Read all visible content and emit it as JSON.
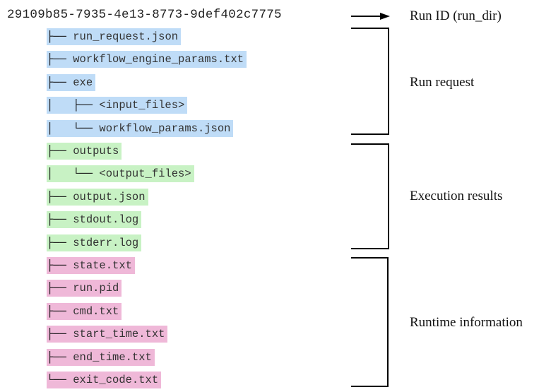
{
  "root": {
    "name": "29109b85-7935-4e13-8773-9def402c7775",
    "annotation": "Run ID (run_dir)"
  },
  "groups": [
    {
      "label": "Run request",
      "color": "#bfdcf7",
      "items": [
        {
          "prefix": "├── ",
          "name": "run_request.json"
        },
        {
          "prefix": "├── ",
          "name": "workflow_engine_params.txt"
        },
        {
          "prefix": "├── ",
          "name": "exe"
        },
        {
          "prefix": "│   ├── ",
          "name": "<input_files>"
        },
        {
          "prefix": "│   └── ",
          "name": "workflow_params.json"
        }
      ]
    },
    {
      "label": "Execution results",
      "color": "#c8f2c4",
      "items": [
        {
          "prefix": "├── ",
          "name": "outputs"
        },
        {
          "prefix": "│   └── ",
          "name": "<output_files>"
        },
        {
          "prefix": "├── ",
          "name": "output.json"
        },
        {
          "prefix": "├── ",
          "name": "stdout.log"
        },
        {
          "prefix": "├── ",
          "name": "stderr.log"
        }
      ]
    },
    {
      "label": "Runtime information",
      "color": "#efb8d8",
      "items": [
        {
          "prefix": "├── ",
          "name": "state.txt"
        },
        {
          "prefix": "├── ",
          "name": "run.pid"
        },
        {
          "prefix": "├── ",
          "name": "cmd.txt"
        },
        {
          "prefix": "├── ",
          "name": "start_time.txt"
        },
        {
          "prefix": "├── ",
          "name": "end_time.txt"
        },
        {
          "prefix": "└── ",
          "name": "exit_code.txt"
        }
      ]
    }
  ]
}
